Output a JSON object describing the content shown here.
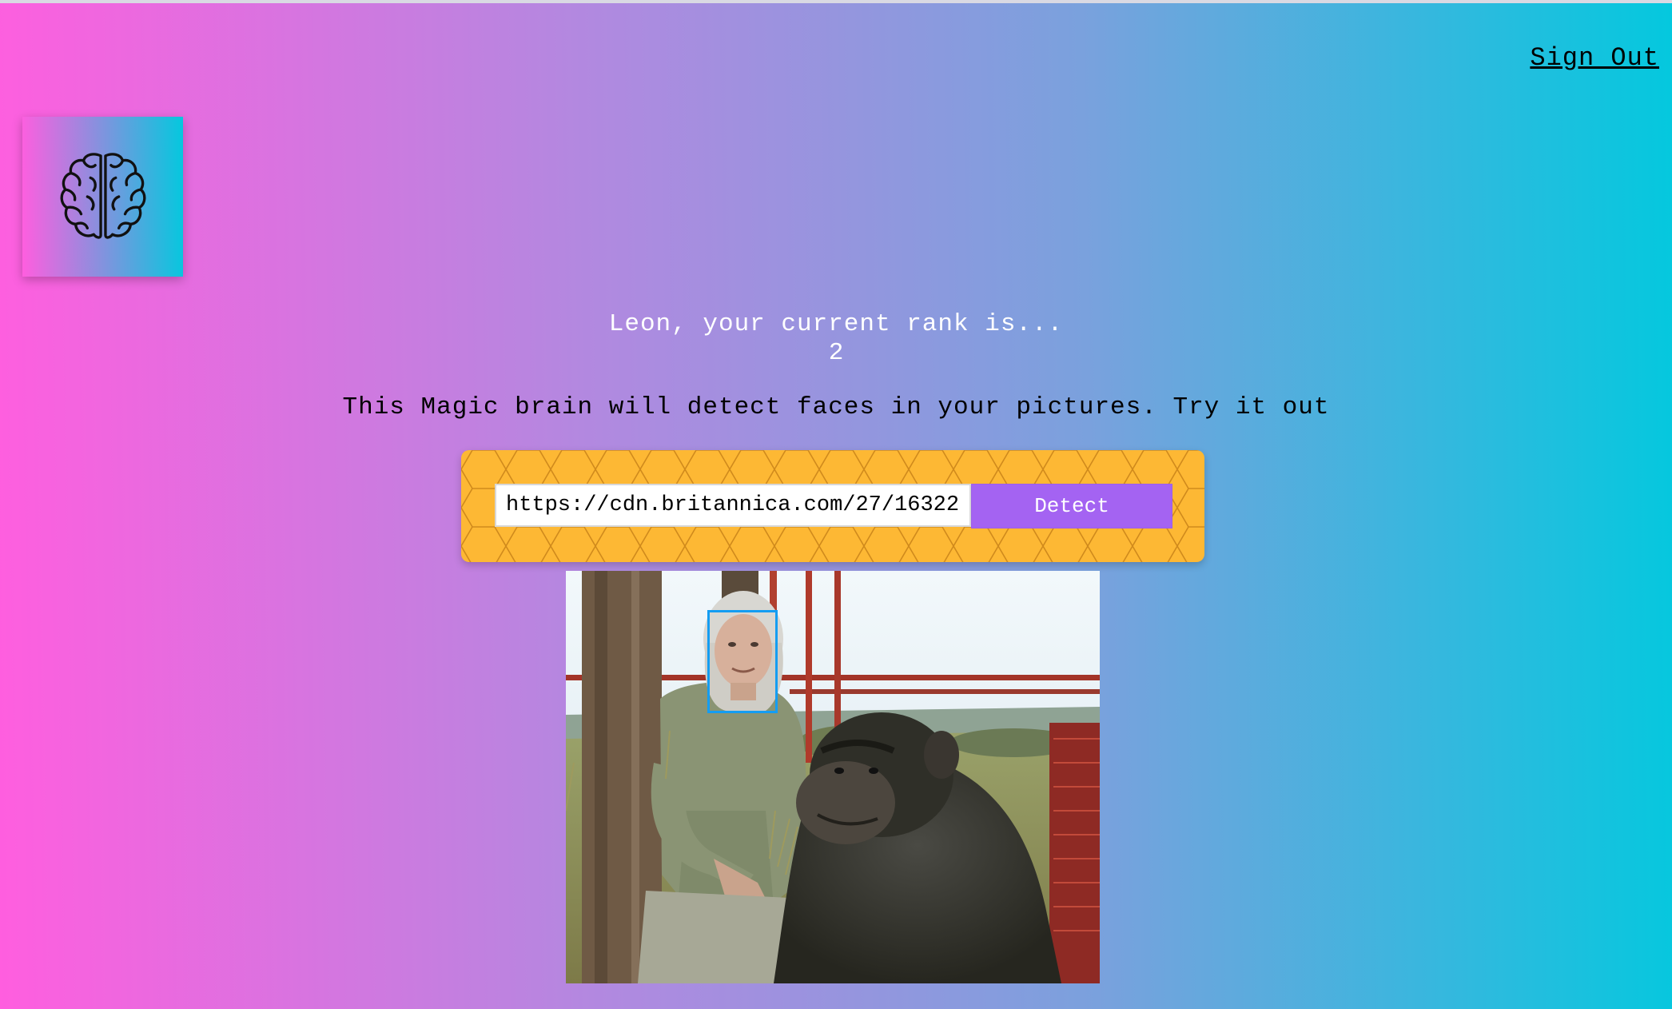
{
  "nav": {
    "sign_out": "Sign Out"
  },
  "logo": {
    "icon": "brain-icon"
  },
  "rank": {
    "message": "Leon, your current rank is...",
    "value": "2"
  },
  "tagline": "This Magic brain will detect faces in your pictures. Try it out",
  "image_form": {
    "input_value": "https://cdn.britannica.com/27/16322",
    "button_label": "Detect"
  },
  "result": {
    "face_count": 1
  },
  "colors": {
    "gradient_start": "#ff5edf",
    "gradient_end": "#04c8de",
    "button": "#a463f2",
    "panel": "#fdb834",
    "face_box": "#149df2"
  }
}
